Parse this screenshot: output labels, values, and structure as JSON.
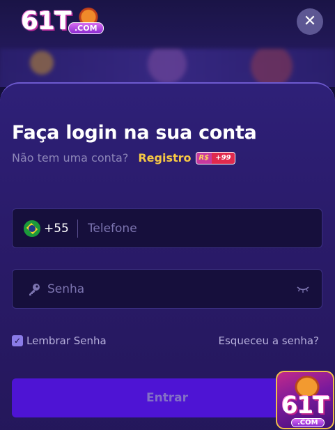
{
  "header": {
    "logo_text": "61T",
    "logo_suffix": ".COM",
    "close_glyph": "✕"
  },
  "login": {
    "title": "Faça login na sua conta",
    "no_account_text": "Não tem uma conta?",
    "register_link": "Registro",
    "bonus_currency": "R$",
    "bonus_amount": "+99",
    "country_code": "+55",
    "phone_placeholder": "Telefone",
    "password_placeholder": "Senha",
    "remember_label": "Lembrar Senha",
    "remember_checked": true,
    "forgot_link": "Esqueceu a senha?",
    "submit_label": "Entrar"
  },
  "floating_app": {
    "logo_text": "61T",
    "logo_suffix": ".COM"
  },
  "icons": {
    "close": "close-icon",
    "flag": "brazil-flag-icon",
    "key": "key-icon",
    "eye": "eye-closed-icon",
    "check": "check-icon"
  },
  "colors": {
    "panel": "#2a1b6a",
    "accent_yellow": "#f6c844",
    "submit_bg": "#4e14d4",
    "field_bg": "#160f3c"
  }
}
